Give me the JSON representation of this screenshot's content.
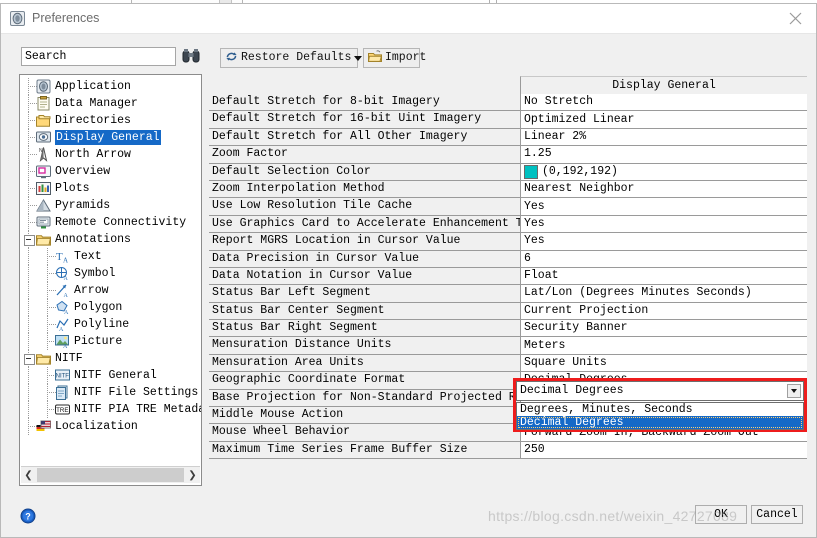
{
  "window": {
    "title": "Preferences",
    "app_icon": "application-icon",
    "close_icon": "close-icon"
  },
  "toolbar": {
    "search": {
      "value": "Search",
      "placeholder": "Search",
      "icon": "binoculars-icon"
    },
    "restore_defaults": {
      "label": "Restore Defaults",
      "icon": "refresh-icon"
    },
    "import": {
      "label": "Import",
      "icon": "open-folder-icon"
    }
  },
  "tree": {
    "items": [
      {
        "label": "Application",
        "icon": "application-icon",
        "indent": 0,
        "expander": false,
        "selected": false
      },
      {
        "label": "Data Manager",
        "icon": "clipboard-icon",
        "indent": 0,
        "expander": false,
        "selected": false
      },
      {
        "label": "Directories",
        "icon": "folders-icon",
        "indent": 0,
        "expander": false,
        "selected": false
      },
      {
        "label": "Display General",
        "icon": "display-icon",
        "indent": 0,
        "expander": false,
        "selected": true
      },
      {
        "label": "North Arrow",
        "icon": "north-arrow-icon",
        "indent": 0,
        "expander": false,
        "selected": false
      },
      {
        "label": "Overview",
        "icon": "overview-icon",
        "indent": 0,
        "expander": false,
        "selected": false
      },
      {
        "label": "Plots",
        "icon": "plots-icon",
        "indent": 0,
        "expander": false,
        "selected": false
      },
      {
        "label": "Pyramids",
        "icon": "pyramid-icon",
        "indent": 0,
        "expander": false,
        "selected": false
      },
      {
        "label": "Remote Connectivity",
        "icon": "remote-connect-icon",
        "indent": 0,
        "expander": false,
        "selected": false
      },
      {
        "label": "Annotations",
        "icon": "folder-icon",
        "indent": 0,
        "expander": true,
        "selected": false
      },
      {
        "label": "Text",
        "icon": "text-annotation-icon",
        "indent": 1,
        "expander": false,
        "selected": false
      },
      {
        "label": "Symbol",
        "icon": "symbol-annotation-icon",
        "indent": 1,
        "expander": false,
        "selected": false
      },
      {
        "label": "Arrow",
        "icon": "arrow-annotation-icon",
        "indent": 1,
        "expander": false,
        "selected": false
      },
      {
        "label": "Polygon",
        "icon": "polygon-annotation-icon",
        "indent": 1,
        "expander": false,
        "selected": false
      },
      {
        "label": "Polyline",
        "icon": "polyline-annotation-icon",
        "indent": 1,
        "expander": false,
        "selected": false
      },
      {
        "label": "Picture",
        "icon": "picture-annotation-icon",
        "indent": 1,
        "expander": false,
        "selected": false
      },
      {
        "label": "NITF",
        "icon": "folder-icon",
        "indent": 0,
        "expander": true,
        "selected": false
      },
      {
        "label": "NITF General",
        "icon": "nitf-icon",
        "indent": 1,
        "expander": false,
        "selected": false
      },
      {
        "label": "NITF File Settings",
        "icon": "nitf-file-icon",
        "indent": 1,
        "expander": false,
        "selected": false
      },
      {
        "label": "NITF PIA TRE Metadata",
        "icon": "tre-icon",
        "indent": 1,
        "expander": false,
        "selected": false
      },
      {
        "label": "Localization",
        "icon": "flags-icon",
        "indent": 0,
        "expander": false,
        "selected": false
      }
    ],
    "scroll_left_icon": "chevron-left-icon",
    "scroll_right_icon": "chevron-right-icon"
  },
  "settings": {
    "column_header": "Display General",
    "rows": [
      {
        "label": "Default Stretch for 8-bit Imagery",
        "value": "No Stretch"
      },
      {
        "label": "Default Stretch for 16-bit Uint Imagery",
        "value": "Optimized Linear"
      },
      {
        "label": "Default Stretch for All Other Imagery",
        "value": "Linear 2%"
      },
      {
        "label": "Zoom Factor",
        "value": "1.25"
      },
      {
        "label": "Default Selection Color",
        "value": "(0,192,192)",
        "swatch": "#00c0c0"
      },
      {
        "label": "Zoom Interpolation Method",
        "value": "Nearest Neighbor"
      },
      {
        "label": "Use Low Resolution Tile Cache",
        "value": "Yes"
      },
      {
        "label": "Use Graphics Card to Accelerate Enhancement Tools",
        "value": "Yes"
      },
      {
        "label": "Report MGRS Location in Cursor Value",
        "value": "Yes"
      },
      {
        "label": "Data Precision in Cursor Value",
        "value": "6"
      },
      {
        "label": "Data Notation in Cursor Value",
        "value": "Float"
      },
      {
        "label": "Status Bar Left Segment",
        "value": "Lat/Lon (Degrees Minutes Seconds)"
      },
      {
        "label": "Status Bar Center Segment",
        "value": "Current Projection"
      },
      {
        "label": "Status Bar Right Segment",
        "value": "Security Banner"
      },
      {
        "label": "Mensuration Distance Units",
        "value": "Meters"
      },
      {
        "label": "Mensuration Area Units",
        "value": "Square Units"
      },
      {
        "label": "Geographic Coordinate Format",
        "value": "Decimal Degrees"
      },
      {
        "label": "Base Projection for Non-Standard Projected Rasters",
        "value": ""
      },
      {
        "label": "Middle Mouse Action",
        "value": ""
      },
      {
        "label": "Mouse Wheel Behavior",
        "value": "Forward Zoom In; Backward Zoom Out"
      },
      {
        "label": "Maximum Time Series Frame Buffer Size",
        "value": "250"
      }
    ]
  },
  "combo": {
    "value": "Decimal Degrees",
    "arrow_icon": "chevron-down-icon",
    "options": [
      {
        "label": "Degrees, Minutes, Seconds",
        "selected": false
      },
      {
        "label": "Decimal Degrees",
        "selected": true
      }
    ],
    "highlight_color": "#ee1c1c"
  },
  "footer": {
    "help_icon": "help-icon",
    "ok_label": "OK",
    "cancel_label": "Cancel"
  },
  "watermark": {
    "text": "https://blog.csdn.net/weixin_42727089"
  }
}
